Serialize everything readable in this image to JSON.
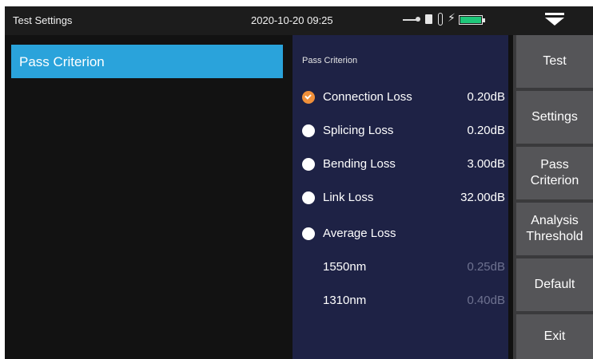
{
  "statusbar": {
    "title": "Test Settings",
    "datetime": "2020-10-20 09:25",
    "icons": [
      "usb-icon",
      "sd-card-icon",
      "thermometer-icon",
      "charging-bolt-icon",
      "battery-icon"
    ],
    "battery_color": "#1fc77a"
  },
  "sidebar": {
    "items": [
      {
        "label": "Pass Criterion",
        "selected": true
      }
    ],
    "accent": "#2aa3db"
  },
  "criteria": {
    "title": "Pass Criterion",
    "items": [
      {
        "label": "Connection Loss",
        "value": "0.20dB",
        "selected": true
      },
      {
        "label": "Splicing Loss",
        "value": "0.20dB",
        "selected": false
      },
      {
        "label": "Bending Loss",
        "value": "3.00dB",
        "selected": false
      },
      {
        "label": "Link Loss",
        "value": "32.00dB",
        "selected": false
      },
      {
        "label": "Average Loss",
        "value": "",
        "selected": false
      }
    ],
    "sub_items": [
      {
        "label": "1550nm",
        "value": "0.25dB"
      },
      {
        "label": "1310nm",
        "value": "0.40dB"
      }
    ],
    "selected_color": "#f0903a",
    "panel_color": "#1e2245"
  },
  "menu": {
    "buttons": [
      "Test",
      "Settings",
      "Pass Criterion",
      "Analysis Threshold",
      "Default",
      "Exit"
    ]
  }
}
